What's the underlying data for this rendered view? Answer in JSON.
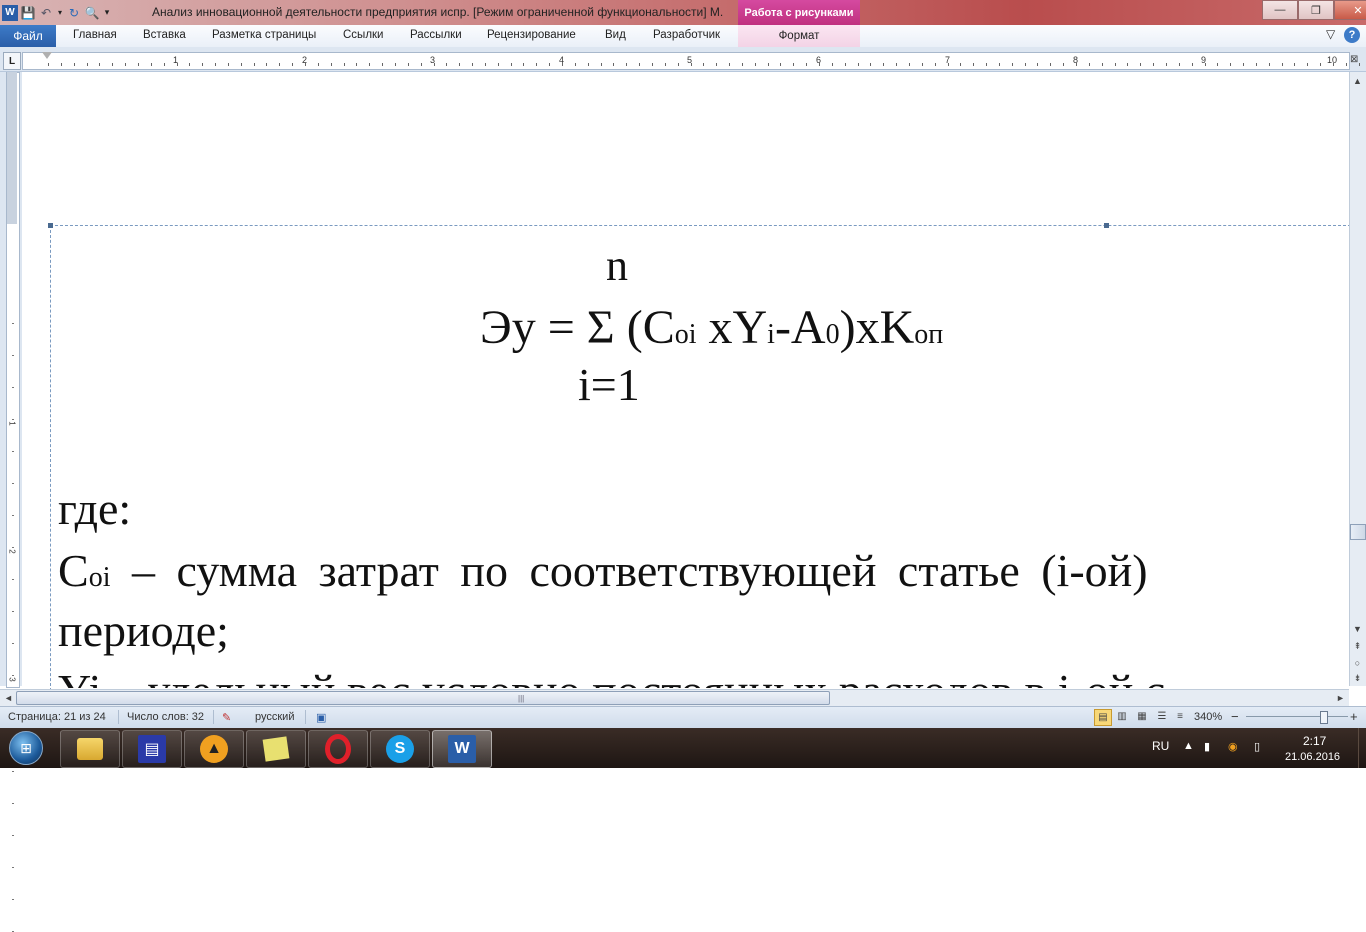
{
  "titlebar": {
    "document_title": "Анализ инновационной деятельности предприятия испр. [Режим ограниченной функциональности] М.",
    "context_tab": "Работа с рисунками",
    "minimize": "—",
    "maximize": "❐",
    "close": "✕"
  },
  "ribbon": {
    "file_tab": "Файл",
    "tabs": [
      "Главная",
      "Вставка",
      "Разметка страницы",
      "Ссылки",
      "Рассылки",
      "Рецензирование",
      "Вид",
      "Разработчик"
    ],
    "context_subtab": "Формат"
  },
  "ruler": {
    "numbers": [
      "1",
      "2",
      "3",
      "4",
      "5",
      "6",
      "7",
      "8",
      "9",
      "10"
    ],
    "vertical_numbers": [
      "1",
      "2",
      "3"
    ]
  },
  "document": {
    "formula": {
      "upper_limit": "n",
      "lhs": "Эу",
      "equals": "=",
      "sigma": "Σ",
      "expr_open": "(C",
      "sub_oi": "oi",
      "expr_x1": " xY",
      "sub_i": "i",
      "expr_a": "-A",
      "sub_0": "0",
      "expr_close": ")xK",
      "sub_op": "оп",
      "lower_limit": "i=1"
    },
    "where_label": "где:",
    "line1_c": "C",
    "line1_sub": "oi",
    "line1_rest": " – сумма затрат по соответствующей статье (i-ой)",
    "line2": "периоде;",
    "line3": "Yi – удельный вес условно постоянных расходов в i-ой с"
  },
  "statusbar": {
    "page": "Страница: 21 из 24",
    "words": "Число слов: 32",
    "language": "русский",
    "zoom": "340%",
    "zoom_minus": "−",
    "zoom_plus": "+"
  },
  "taskbar": {
    "language": "RU",
    "time": "2:17",
    "date": "21.06.2016"
  }
}
